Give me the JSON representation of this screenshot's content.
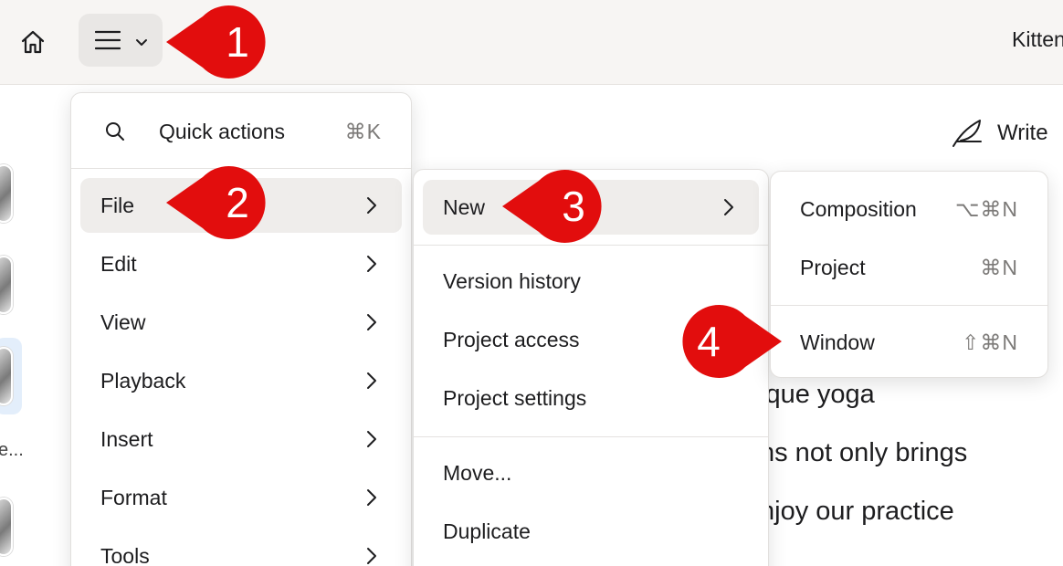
{
  "topbar": {
    "title": "Kitten"
  },
  "document": {
    "write_label": "Write",
    "lines": [
      "ique yoga",
      "ns not only brings",
      "njoy our practice"
    ],
    "sidebar_ellipsis": "e..."
  },
  "main_menu": {
    "quick_actions": {
      "label": "Quick actions",
      "shortcut": "⌘K"
    },
    "items": [
      {
        "label": "File"
      },
      {
        "label": "Edit"
      },
      {
        "label": "View"
      },
      {
        "label": "Playback"
      },
      {
        "label": "Insert"
      },
      {
        "label": "Format"
      },
      {
        "label": "Tools"
      }
    ]
  },
  "file_menu": {
    "items": [
      {
        "label": "New"
      },
      {
        "label": "Version history"
      },
      {
        "label": "Project access"
      },
      {
        "label": "Project settings"
      },
      {
        "label": "Move..."
      },
      {
        "label": "Duplicate"
      }
    ]
  },
  "new_menu": {
    "items": [
      {
        "label": "Composition",
        "shortcut": "⌥⌘N"
      },
      {
        "label": "Project",
        "shortcut": "⌘N"
      },
      {
        "label": "Window",
        "shortcut": "⇧⌘N"
      }
    ]
  },
  "callouts": [
    "1",
    "2",
    "3",
    "4"
  ],
  "colors": {
    "callout": "#e20d0d",
    "menu_active": "#efedeb",
    "topbar": "#f7f5f3"
  }
}
